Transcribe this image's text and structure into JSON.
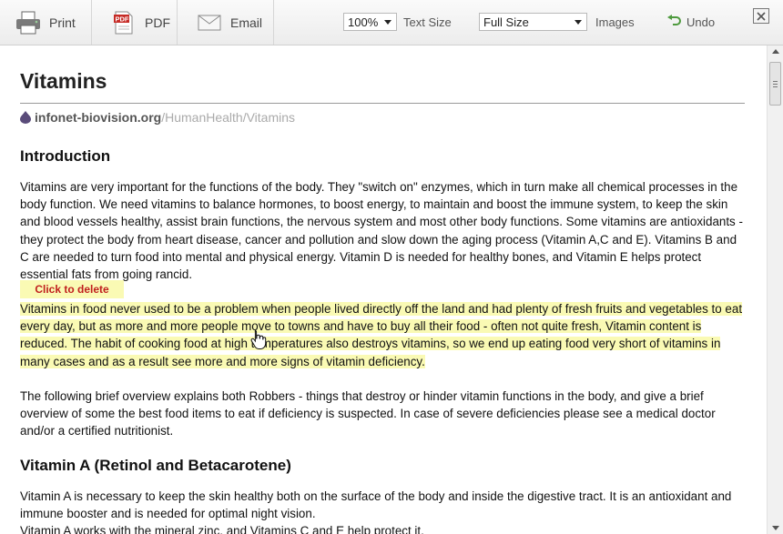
{
  "toolbar": {
    "print_label": "Print",
    "pdf_label": "PDF",
    "pdf_icon_text": "PDF",
    "email_label": "Email",
    "text_size": {
      "value": "100%",
      "label": "Text Size"
    },
    "images": {
      "value": "Full Size",
      "label": "Images"
    },
    "undo_label": "Undo"
  },
  "article": {
    "title": "Vitamins",
    "source_domain": "infonet-biovision.org",
    "source_path": "/HumanHealth/Vitamins",
    "delete_tip": "Click to delete",
    "sections": [
      {
        "heading": "Introduction",
        "paragraphs": [
          "Vitamins are very important for the functions of the body. They \"switch on\" enzymes, which in turn make all chemical processes in the body function. We need vitamins to balance hormones, to boost energy, to maintain and boost the immune system, to keep the skin and blood vessels healthy, assist brain functions, the nervous system and most other body functions. Some vitamins are antioxidants - they protect the body from heart disease, cancer and pollution and slow down the aging process (Vitamin A,C and E). Vitamins B and C are needed to turn food into mental and physical energy. Vitamin D is needed for healthy bones, and Vitamin E helps protect essential fats from going rancid.",
          "Vitamins in food never used to be a problem when people lived directly off the land and had plenty of fresh fruits and vegetables to eat every day, but as more and more people move to towns and have to buy all their food - often not quite fresh, Vitamin content is reduced. The habit of cooking food at high temperatures also destroys vitamins, so we end up eating food very short of vitamins in many cases and as a result see more and more signs of vitamin deficiency.",
          "The following brief overview explains both Robbers - things that destroy or hinder vitamin functions in the body, and give a brief overview of some the best food items to eat if deficiency is suspected. In case of severe deficiencies please see a medical doctor and/or a certified nutritionist."
        ]
      },
      {
        "heading": "Vitamin A (Retinol and Betacarotene)",
        "paragraphs": [
          "Vitamin A is necessary to keep the skin healthy both on the surface of the body and inside the digestive tract. It is an antioxidant and immune booster and is needed for optimal night vision.",
          "Vitamin A works with the mineral zinc, and Vitamins C and E help protect it."
        ]
      }
    ]
  }
}
